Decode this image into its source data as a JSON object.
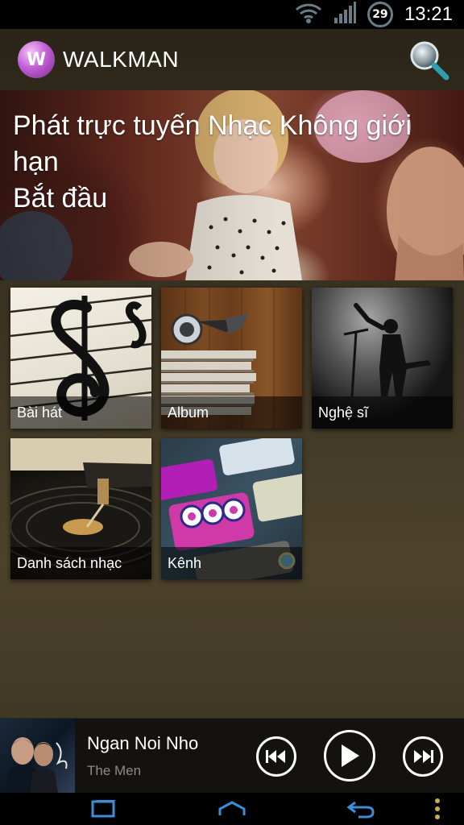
{
  "status_bar": {
    "wifi_icon": "wifi-icon",
    "signal_icon": "signal-icon",
    "battery_level": "29",
    "time": "13:21"
  },
  "header": {
    "app_title": "WALKMAN",
    "logo_letter": "W",
    "search_icon": "search-icon"
  },
  "banner": {
    "line1": "Phát trực tuyến Nhạc Không giới hạn",
    "line2": "Bắt đầu"
  },
  "tiles": [
    {
      "label": "Bài hát",
      "icon": "treble-clef-art"
    },
    {
      "label": "Album",
      "icon": "headphones-records-art"
    },
    {
      "label": "Nghệ sĩ",
      "icon": "singer-stage-art"
    },
    {
      "label": "Danh sách nhạc",
      "icon": "turntable-art"
    },
    {
      "label": "Kênh",
      "icon": "pop-channel-art"
    }
  ],
  "now_playing": {
    "title": "Ngan Noi Nho",
    "artist": "The Men",
    "controls": [
      "previous-icon",
      "play-icon",
      "next-icon"
    ]
  },
  "nav_bar": {
    "buttons": [
      "recent-apps-icon",
      "home-icon",
      "back-icon",
      "menu-icon"
    ]
  },
  "colors": {
    "background_top": "#2b2519",
    "background_mid": "#4d432c",
    "accent_logo": "#c260d6",
    "nav_icon": "#3a8fd6"
  }
}
